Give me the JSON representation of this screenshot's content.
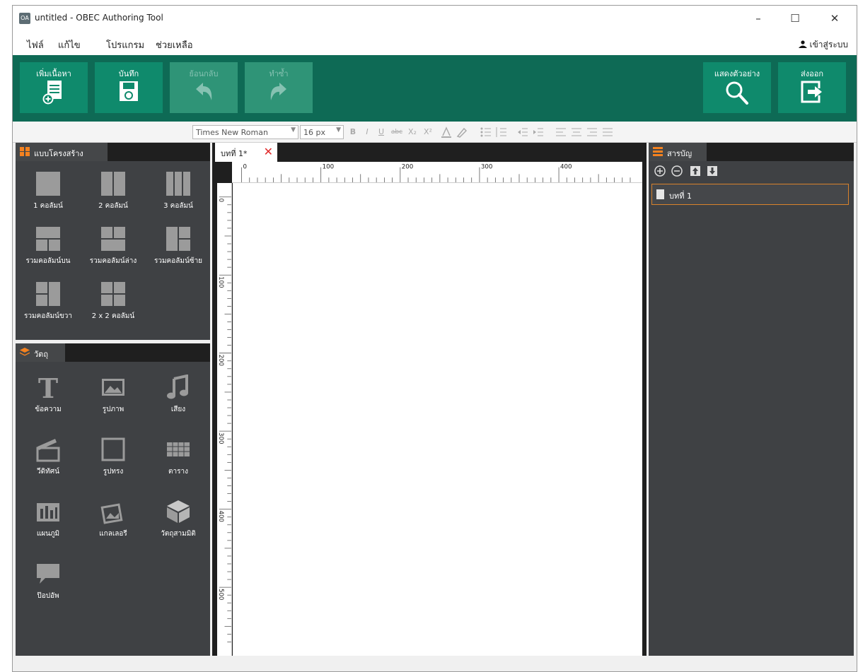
{
  "titlebar": {
    "app_icon_text": "OA",
    "title": "untitled - OBEC Authoring Tool",
    "minimize": "–",
    "maximize": "☐",
    "close": "✕"
  },
  "menu": {
    "items": [
      "ไฟล์",
      "แก้ไข",
      "โปรแกรม",
      "ช่วยเหลือ"
    ],
    "login_label": "เข้าสู่ระบบ"
  },
  "ribbon": {
    "new_doc": "เพิ่มเนื้อหา",
    "save": "บันทึก",
    "undo": "ย้อนกลับ",
    "redo": "ทำซ้ำ",
    "preview": "แสดงตัวอย่าง",
    "export": "ส่งออก"
  },
  "format_toolbar": {
    "font": "Times New Roman",
    "size": "16 px",
    "bold": "B",
    "italic": "I",
    "underline": "U",
    "strike": "abc",
    "subscript": "X₂",
    "superscript": "X²"
  },
  "layout_panel": {
    "title": "แบบโครงสร้าง",
    "items": [
      {
        "label": "1 คอลัมน์",
        "icon": "one-column-icon"
      },
      {
        "label": "2 คอลัมน์",
        "icon": "two-column-icon"
      },
      {
        "label": "3 คอลัมน์",
        "icon": "three-column-icon"
      },
      {
        "label": "รวมคอลัมน์บน",
        "icon": "merge-top-icon"
      },
      {
        "label": "รวมคอลัมน์ล่าง",
        "icon": "merge-bottom-icon"
      },
      {
        "label": "รวมคอลัมน์ซ้าย",
        "icon": "merge-left-icon"
      },
      {
        "label": "รวมคอลัมน์ขวา",
        "icon": "merge-right-icon"
      },
      {
        "label": "2 x 2 คอลัมน์",
        "icon": "grid-2x2-icon"
      }
    ]
  },
  "objects_panel": {
    "title": "วัตถุ",
    "items": [
      {
        "label": "ข้อความ",
        "icon": "text-icon"
      },
      {
        "label": "รูปภาพ",
        "icon": "image-icon"
      },
      {
        "label": "เสียง",
        "icon": "music-icon"
      },
      {
        "label": "วีดิทัศน์",
        "icon": "clapper-icon"
      },
      {
        "label": "รูปทรง",
        "icon": "shape-icon"
      },
      {
        "label": "ตาราง",
        "icon": "table-icon"
      },
      {
        "label": "แผนภูมิ",
        "icon": "chart-icon"
      },
      {
        "label": "แกลเลอรี",
        "icon": "gallery-icon"
      },
      {
        "label": "วัตถุสามมิติ",
        "icon": "cube-icon"
      },
      {
        "label": "ป๊อปอัพ",
        "icon": "speech-bubble-icon"
      }
    ]
  },
  "document": {
    "tab_label": "บทที่ 1*",
    "hruler_ticks": [
      "0",
      "100",
      "200",
      "300",
      "400"
    ],
    "vruler_ticks": [
      "0",
      "100",
      "200",
      "300",
      "400",
      "500"
    ]
  },
  "toc_panel": {
    "title": "สารบัญ",
    "items": [
      "บทที่ 1"
    ]
  },
  "colors": {
    "ribbon": "#0e6a55",
    "ribbon_button": "#0f8a6c",
    "panel": "#3f4144",
    "panel_tab_accent": "#f5821f",
    "close_tab": "#e02a2a"
  }
}
